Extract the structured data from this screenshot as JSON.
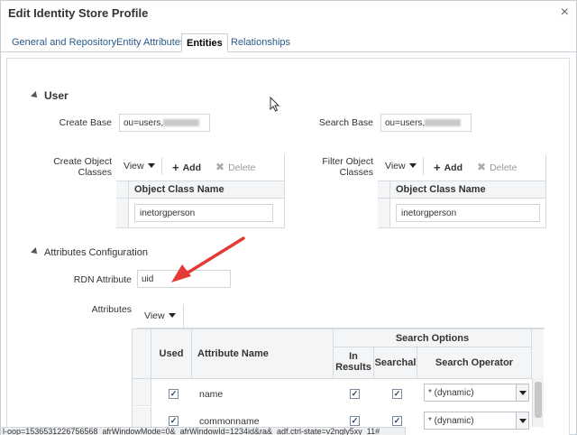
{
  "window": {
    "title": "Edit Identity Store Profile",
    "close_glyph": "×"
  },
  "tabs": [
    {
      "label": "General and Repository"
    },
    {
      "label": "Entity Attributes"
    },
    {
      "label": "Entities"
    },
    {
      "label": "Relationships"
    }
  ],
  "user_section": {
    "title": "User",
    "create_base_label": "Create Base",
    "create_base_value": "ou=users,",
    "search_base_label": "Search Base",
    "search_base_value": "ou=users,",
    "create_object_classes_label_1": "Create Object",
    "create_object_classes_label_2": "Classes",
    "filter_object_classes_label_1": "Filter Object",
    "filter_object_classes_label_2": "Classes",
    "toolbar": {
      "view": "View",
      "add": "Add",
      "delete": "Delete"
    },
    "object_class_header": "Object Class Name",
    "create_object_class_value": "inetorgperson",
    "filter_object_class_value": "inetorgperson"
  },
  "attributes_config": {
    "title": "Attributes Configuration",
    "rdn_label": "RDN Attribute",
    "rdn_value": "uid",
    "attributes_label": "Attributes",
    "view": "View",
    "headers": {
      "used": "Used",
      "attribute_name": "Attribute Name",
      "search_options": "Search Options",
      "in_results_1": "In",
      "in_results_2": "Results",
      "searchable": "Searchal",
      "search_operator": "Search Operator"
    },
    "rows": [
      {
        "name": "name",
        "operator": "* (dynamic)"
      },
      {
        "name": "commonname",
        "operator": "* (dynamic)"
      }
    ]
  },
  "status_bar": {
    "text": "l-oop=1536531226756568_afrWindowMode=0&_afrWindowId=1234id&ra&_adf.ctrl-state=v2ngly5xy_11#"
  },
  "colors": {
    "accent": "#2a5a8a",
    "annotation_arrow": "#e53935"
  }
}
